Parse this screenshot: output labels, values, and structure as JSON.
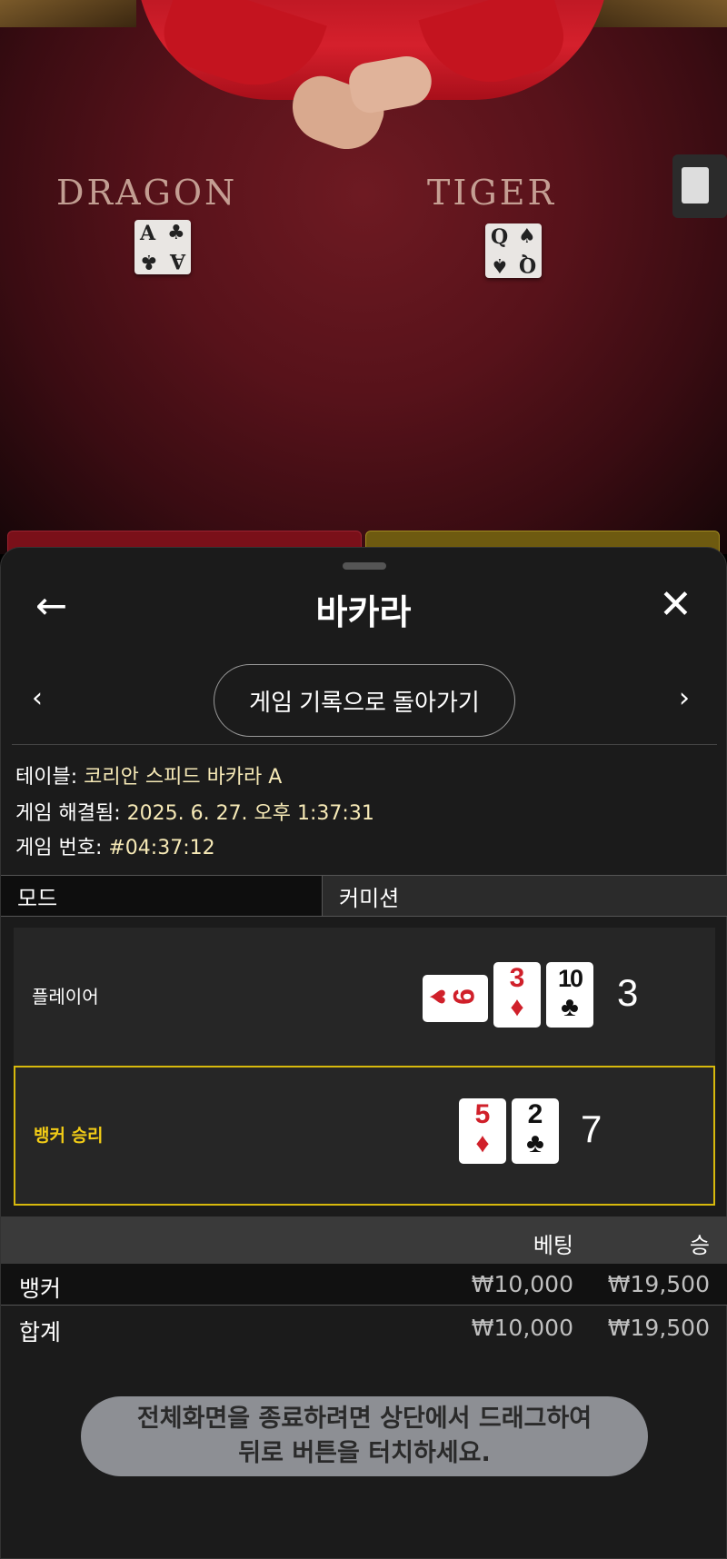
{
  "video": {
    "dragon_label": "DRAGON",
    "tiger_label": "TIGER",
    "dragon_card": {
      "rank": "A",
      "suit": "♣"
    },
    "tiger_card": {
      "rank": "Q",
      "suit": "♠"
    }
  },
  "header": {
    "title": "바카라",
    "back_icon": "←",
    "close_icon": "✕"
  },
  "nav": {
    "prev_icon": "‹",
    "next_icon": "›",
    "back_to_history": "게임 기록으로 돌아가기"
  },
  "info": {
    "table_label": "테이블: ",
    "table_value": "코리안 스피드 바카라 A",
    "resolved_label": "게임 해결됨: ",
    "resolved_value": "2025. 6. 27. 오후 1:37:31",
    "number_label": "게임 번호: ",
    "number_value": "#04:37:12"
  },
  "mode": {
    "mode_label": "모드",
    "mode_value": "커미션"
  },
  "results": {
    "player": {
      "label": "플레이어",
      "cards": [
        {
          "rank": "9",
          "suit": "♥",
          "color": "red",
          "sideways": true
        },
        {
          "rank": "3",
          "suit": "♦",
          "color": "red"
        },
        {
          "rank": "10",
          "suit": "♣",
          "color": "black"
        }
      ],
      "score": "3"
    },
    "banker": {
      "label": "뱅커 승리",
      "cards": [
        {
          "rank": "5",
          "suit": "♦",
          "color": "red"
        },
        {
          "rank": "2",
          "suit": "♣",
          "color": "black"
        }
      ],
      "score": "7"
    },
    "win_border_color": "#d7b90c"
  },
  "bets": {
    "header_bet": "베팅",
    "header_win": "승",
    "rows": [
      {
        "label": "뱅커",
        "bet": "₩10,000",
        "win": "₩19,500"
      },
      {
        "label": "합계",
        "bet": "₩10,000",
        "win": "₩19,500"
      }
    ]
  },
  "toast": {
    "line1": "전체화면을 종료하려면 상단에서 드래그하여",
    "line2": "뒤로 버튼을 터치하세요."
  }
}
